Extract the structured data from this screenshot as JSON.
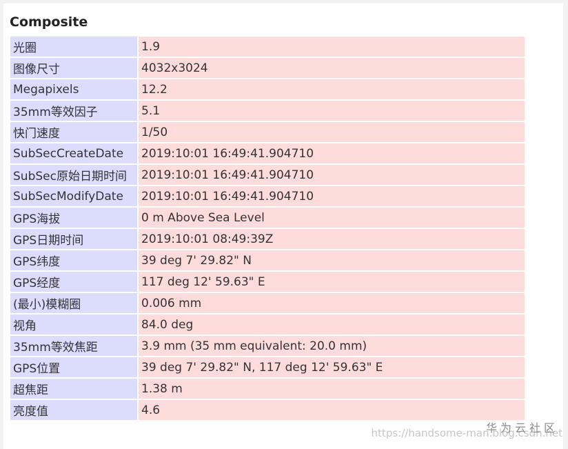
{
  "section": {
    "title": "Composite"
  },
  "rows": [
    {
      "label": "光圈",
      "value": "1.9"
    },
    {
      "label": "图像尺寸",
      "value": "4032x3024"
    },
    {
      "label": "Megapixels",
      "value": "12.2"
    },
    {
      "label": "35mm等效因子",
      "value": "5.1"
    },
    {
      "label": "快门速度",
      "value": "1/50"
    },
    {
      "label": "SubSecCreateDate",
      "value": "2019:10:01 16:49:41.904710"
    },
    {
      "label": "SubSec原始日期时间",
      "value": "2019:10:01 16:49:41.904710"
    },
    {
      "label": "SubSecModifyDate",
      "value": "2019:10:01 16:49:41.904710"
    },
    {
      "label": "GPS海拔",
      "value": "0 m Above Sea Level"
    },
    {
      "label": "GPS日期时间",
      "value": "2019:10:01 08:49:39Z"
    },
    {
      "label": "GPS纬度",
      "value": "39 deg 7' 29.82\" N"
    },
    {
      "label": "GPS经度",
      "value": "117 deg 12' 59.63\" E"
    },
    {
      "label": "(最小)模糊圈",
      "value": "0.006 mm"
    },
    {
      "label": "视角",
      "value": "84.0 deg"
    },
    {
      "label": "35mm等效焦距",
      "value": "3.9 mm (35 mm equivalent: 20.0 mm)"
    },
    {
      "label": "GPS位置",
      "value": "39 deg 7' 29.82\" N, 117 deg 12' 59.63\" E"
    },
    {
      "label": "超焦距",
      "value": "1.38 m"
    },
    {
      "label": "亮度值",
      "value": "4.6"
    }
  ],
  "watermark": {
    "brand": "华为云社区",
    "url": "https://handsome-man.blog.csdn.net"
  },
  "colors": {
    "label_bg": "#dcdcff",
    "value_bg": "#ffdcdc"
  }
}
